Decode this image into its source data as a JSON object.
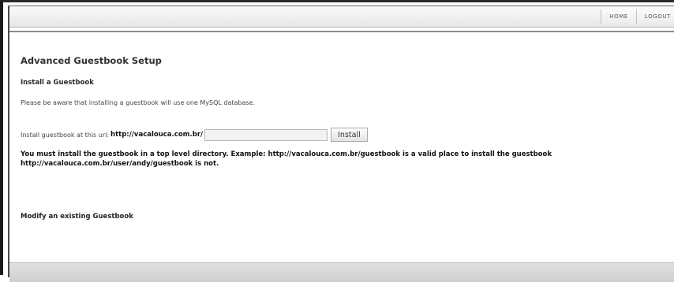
{
  "nav": {
    "home": "HOME",
    "logout": "LOGOUT"
  },
  "page": {
    "title": "Advanced Guestbook Setup",
    "section_title": "Install a Guestbook",
    "warning": "Please be aware that installing a guestbook will use one MySQL database.",
    "install_label": "Install guestbook at this url:",
    "install_url": "http://vacalouca.com.br/",
    "url_input_value": "",
    "install_button": "Install",
    "note": "You must install the guestbook in a top level directory. Example: http://vacalouca.com.br/guestbook is a valid place to install the guestbook http://vacalouca.com.br/user/andy/guestbook is not.",
    "modify_link": "Modify an existing Guestbook"
  }
}
